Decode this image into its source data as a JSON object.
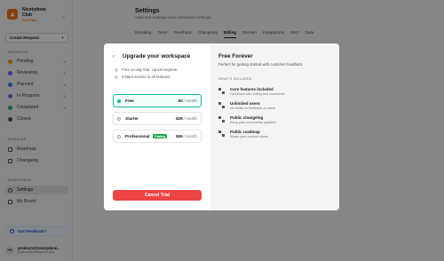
{
  "workspace": {
    "name_line1": "Nicetydone",
    "name_line2": "Club",
    "plan": "Pro Plan"
  },
  "sidebar": {
    "create_label": "Create Request",
    "create_plus": "+",
    "requests_label": "REQUESTS",
    "requests": [
      {
        "label": "Pending",
        "count": "0",
        "color": "#f59e0b"
      },
      {
        "label": "Reviewing",
        "count": "0",
        "color": "#8b5cf6"
      },
      {
        "label": "Planned",
        "count": "0",
        "color": "#3b82f6"
      },
      {
        "label": "In Progress",
        "count": "0",
        "color": "#a855f7"
      },
      {
        "label": "Completed",
        "count": "0",
        "color": "#22c55e"
      },
      {
        "label": "Closed",
        "count": "",
        "color": "#52525b"
      }
    ],
    "modules_label": "MODULES",
    "modules": [
      {
        "label": "Roadmap"
      },
      {
        "label": "Changelog"
      }
    ],
    "workspace_label": "WORKSPACE",
    "workspace_items": [
      {
        "label": "Settings"
      },
      {
        "label": "My Board"
      }
    ],
    "feedback_label": "Got Feedback?",
    "user": {
      "initials": "PR",
      "name": "products@nicetydone...",
      "email": "products@nicetydone.club"
    }
  },
  "main": {
    "title": "Settings",
    "subtitle": "View and manage your workspace settings.",
    "tabs": [
      "Branding",
      "Team",
      "Feedback",
      "Changelog",
      "Billing",
      "Domain",
      "Integrations",
      "SSO",
      "Data"
    ]
  },
  "modal": {
    "back_icon": "‹",
    "title": "Upgrade your workspace",
    "bullets": [
      "Free 14-day trial, cancel anytime.",
      "Instant access to all features."
    ],
    "plans": [
      {
        "name": "Free",
        "badge": "",
        "price": "$0",
        "per": "/ month",
        "selected": true
      },
      {
        "name": "Starter",
        "badge": "",
        "price": "$29",
        "per": "/ month",
        "selected": false
      },
      {
        "name": "Professional",
        "badge": "Trialing",
        "price": "$59",
        "per": "/ month",
        "selected": false
      }
    ],
    "cancel_label": "Cancel Trial",
    "detail": {
      "title": "Free Forever",
      "subtitle": "Perfect for getting started with customer feedback",
      "included_label": "WHAT'S INCLUDED",
      "features": [
        {
          "title": "Core features included",
          "desc": "Feedback with voting and comments"
        },
        {
          "title": "Unlimited users",
          "desc": "No limits on feedback or users"
        },
        {
          "title": "Public changelog",
          "desc": "Keep your community updated"
        },
        {
          "title": "Public roadmap",
          "desc": "Share your product vision"
        }
      ]
    }
  }
}
